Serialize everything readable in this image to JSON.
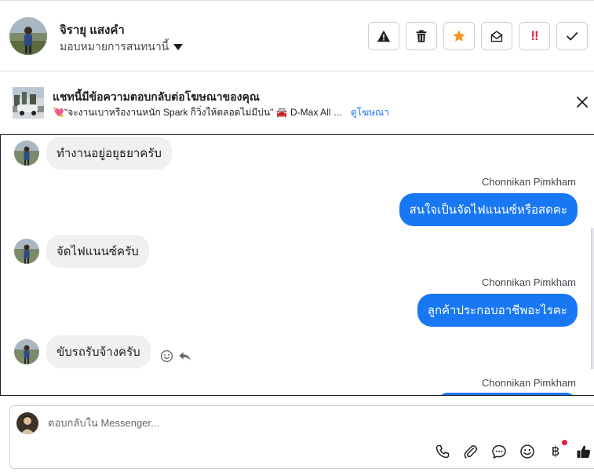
{
  "header": {
    "contact_name": "จิรายุ แสงคำ",
    "assign_label": "มอบหมายการสนทนานี้",
    "actions": [
      {
        "name": "warning-icon",
        "label": "spam"
      },
      {
        "name": "trash-icon",
        "label": "delete"
      },
      {
        "name": "star-icon",
        "label": "star",
        "color": "#f7931e"
      },
      {
        "name": "envelope-open-icon",
        "label": "mark unread"
      },
      {
        "name": "follow-up-icon",
        "label": "follow up",
        "color": "#e41e3f"
      },
      {
        "name": "check-icon",
        "label": "done"
      }
    ]
  },
  "ad": {
    "title": "แชทนี้มีข้อความตอบกลับต่อโฆษณาของคุณ",
    "text": "💘\"จะงานเบาหรืองานหนัก Spark ก็วิ่งให้ตลอดไม่มีบ่น\" 🚘 D-Max All New Spark",
    "link": "ดูโฆษณา"
  },
  "messages": [
    {
      "dir": "in",
      "text": "ทำงานอยู่อยุธยาครับ"
    },
    {
      "dir": "out",
      "sender": "Chonnikan Pimkham",
      "text": "สนใจเป็นจัดไฟแนนซ์หรือสดคะ"
    },
    {
      "dir": "in",
      "text": "จัดไฟแนนซ์ครับ"
    },
    {
      "dir": "out",
      "sender": "Chonnikan Pimkham",
      "text": "ลูกค้าประกอบอาชีพอะไรคะ"
    },
    {
      "dir": "in",
      "text": "ขับรถรับจ้างครับ"
    },
    {
      "dir": "out",
      "sender": "Chonnikan Pimkham",
      "text": ""
    }
  ],
  "composer": {
    "placeholder": "ตอบกลับใน Messenger...",
    "value": ""
  },
  "colors": {
    "accent": "#1877f2",
    "alert": "#e41e3f",
    "star": "#f7931e"
  }
}
